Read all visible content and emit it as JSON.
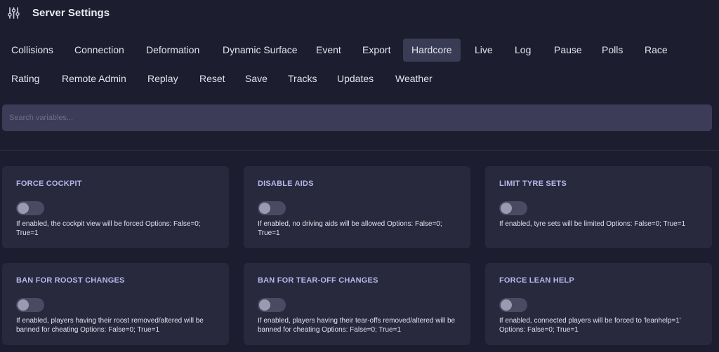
{
  "header": {
    "icon": "sliders-icon",
    "title": "Server Settings"
  },
  "tabs": [
    {
      "label": "Collisions"
    },
    {
      "label": "Connection"
    },
    {
      "label": "Deformation"
    },
    {
      "label": "Dynamic Surface"
    },
    {
      "label": "Event"
    },
    {
      "label": "Export"
    },
    {
      "label": "Hardcore",
      "active": true
    },
    {
      "label": "Live"
    },
    {
      "label": "Log"
    },
    {
      "label": "Pause"
    },
    {
      "label": "Polls"
    },
    {
      "label": "Race"
    },
    {
      "label": "Rating"
    },
    {
      "label": "Remote Admin"
    },
    {
      "label": "Replay"
    },
    {
      "label": "Reset"
    },
    {
      "label": "Save"
    },
    {
      "label": "Tracks"
    },
    {
      "label": "Updates"
    },
    {
      "label": "Weather"
    }
  ],
  "search": {
    "placeholder": "Search variables...",
    "value": ""
  },
  "cards": [
    {
      "title": "FORCE COCKPIT",
      "enabled": false,
      "description": "If enabled, the cockpit view will be forced Options: False=0; True=1"
    },
    {
      "title": "DISABLE AIDS",
      "enabled": false,
      "description": "If enabled, no driving aids will be allowed Options: False=0; True=1"
    },
    {
      "title": "LIMIT TYRE SETS",
      "enabled": false,
      "description": "If enabled, tyre sets will be limited Options: False=0; True=1"
    },
    {
      "title": "BAN FOR ROOST CHANGES",
      "enabled": false,
      "description": "If enabled, players having their roost removed/altered will be banned for cheating Options: False=0; True=1"
    },
    {
      "title": "BAN FOR TEAR-OFF CHANGES",
      "enabled": false,
      "description": "If enabled, players having their tear-offs removed/altered will be banned for cheating Options: False=0; True=1"
    },
    {
      "title": "FORCE LEAN HELP",
      "enabled": false,
      "description": "If enabled, connected players will be forced to 'leanhelp=1' Options: False=0; True=1"
    }
  ],
  "colors": {
    "background": "#1c1d2e",
    "card": "#28293d",
    "active_tab": "#3a3b54",
    "card_title": "#b6b8ea"
  }
}
